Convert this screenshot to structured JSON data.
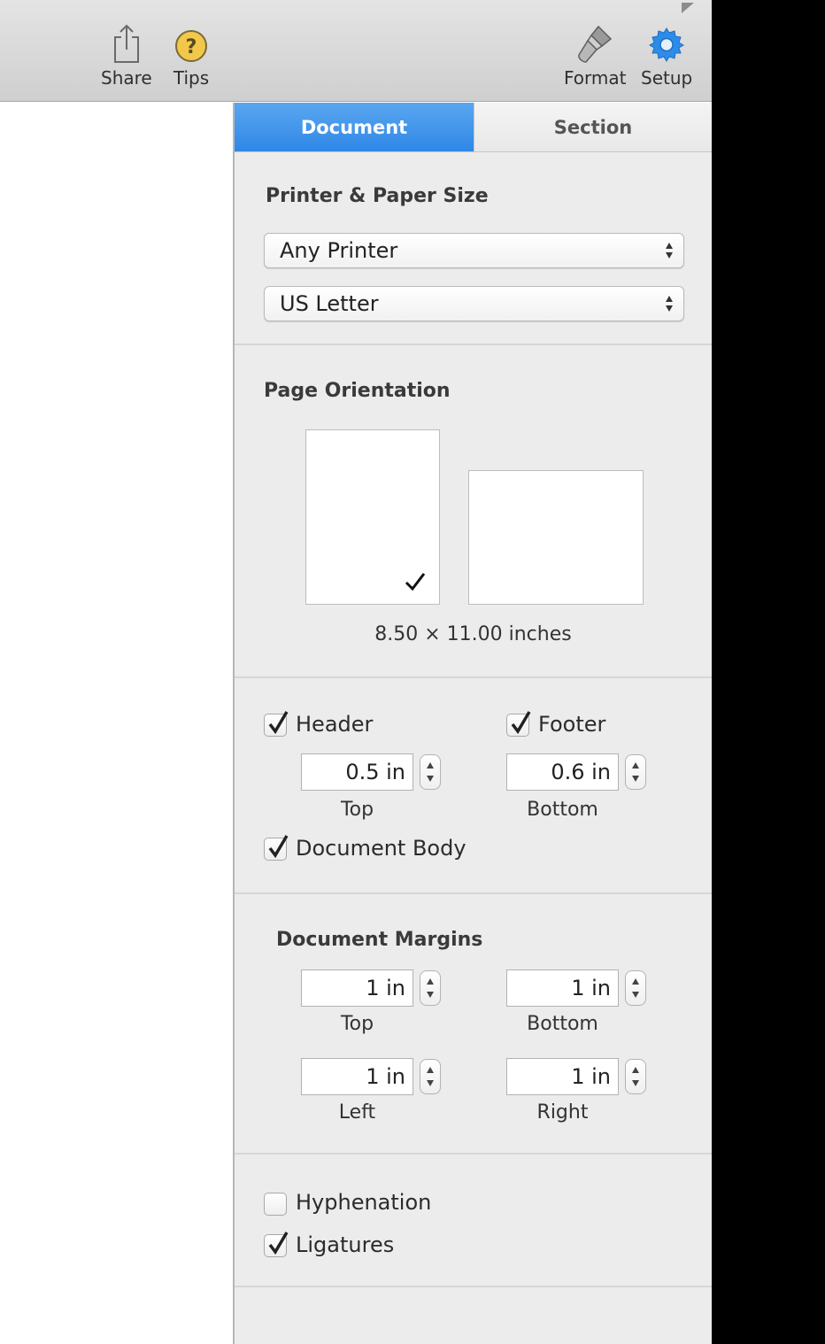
{
  "toolbar": {
    "share_label": "Share",
    "tips_label": "Tips",
    "format_label": "Format",
    "setup_label": "Setup"
  },
  "tabs": {
    "document": "Document",
    "section": "Section"
  },
  "printer_section": {
    "heading": "Printer & Paper Size",
    "printer": "Any Printer",
    "paper": "US Letter"
  },
  "orientation_section": {
    "heading": "Page Orientation",
    "selected": "portrait",
    "size_caption": "8.50 × 11.00 inches"
  },
  "header_footer": {
    "header_label": "Header",
    "header_checked": true,
    "footer_label": "Footer",
    "footer_checked": true,
    "header_value": "0.5 in",
    "footer_value": "0.6 in",
    "top_label": "Top",
    "bottom_label": "Bottom",
    "body_label": "Document Body",
    "body_checked": true
  },
  "margins": {
    "heading": "Document Margins",
    "top_value": "1 in",
    "bottom_value": "1 in",
    "left_value": "1 in",
    "right_value": "1 in",
    "top_label": "Top",
    "bottom_label": "Bottom",
    "left_label": "Left",
    "right_label": "Right"
  },
  "options": {
    "hyphenation_label": "Hyphenation",
    "hyphenation_checked": false,
    "ligatures_label": "Ligatures",
    "ligatures_checked": true
  },
  "colors": {
    "accent": "#2f87e6",
    "tips_icon": "#f2c84b",
    "setup_icon": "#2d8ce8"
  }
}
